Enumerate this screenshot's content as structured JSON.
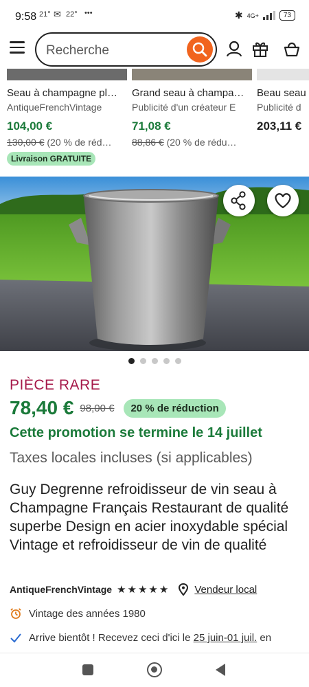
{
  "status_bar": {
    "time": "9:58",
    "temp1": "21°",
    "temp2": "22°",
    "more": "•••",
    "network": "4G+",
    "battery": "73"
  },
  "header": {
    "search_placeholder": "Recherche"
  },
  "related": [
    {
      "title": "Seau à champagne pl…",
      "shop": "AntiqueFrenchVintage",
      "price": "104,00 €",
      "old_price": "130,00 €",
      "discount": "(20 % de réd…",
      "badge": "Livraison GRATUITE"
    },
    {
      "title": "Grand seau à champa…",
      "shop": "Publicité d'un créateur E",
      "price": "71,08 €",
      "old_price": "88,86 €",
      "discount": "(20 % de rédu…"
    },
    {
      "title": "Beau seau",
      "shop": "Publicité d",
      "price": "203,11 €"
    }
  ],
  "hero": {
    "dots_total": 5,
    "dots_active": 1
  },
  "product": {
    "label": "PIÈCE RARE",
    "price": "78,40 €",
    "old_price": "98,00 €",
    "discount": "20 % de réduction",
    "promo": "Cette promotion se termine le 14 juillet",
    "taxes": "Taxes locales incluses (si applicables)",
    "title": "Guy Degrenne refroidisseur de vin seau à Champagne Français Restaurant de qualité superbe Design en acier inoxydable spécial Vintage et refroidisseur de vin de qualité",
    "shop": "AntiqueFrenchVintage",
    "stars": "★★★★★",
    "rating": 5,
    "local_seller": "Vendeur local",
    "vintage": "Vintage des années 1980",
    "delivery_prefix": "Arrive bientôt ! Recevez ceci d'ici le ",
    "delivery_dates": "25 juin-01 juil.",
    "delivery_suffix": " en"
  },
  "colors": {
    "accent": "#f1641e",
    "price_green": "#1b7a3a",
    "badge_green": "#a8e6b8",
    "rare": "#a61a4a"
  }
}
